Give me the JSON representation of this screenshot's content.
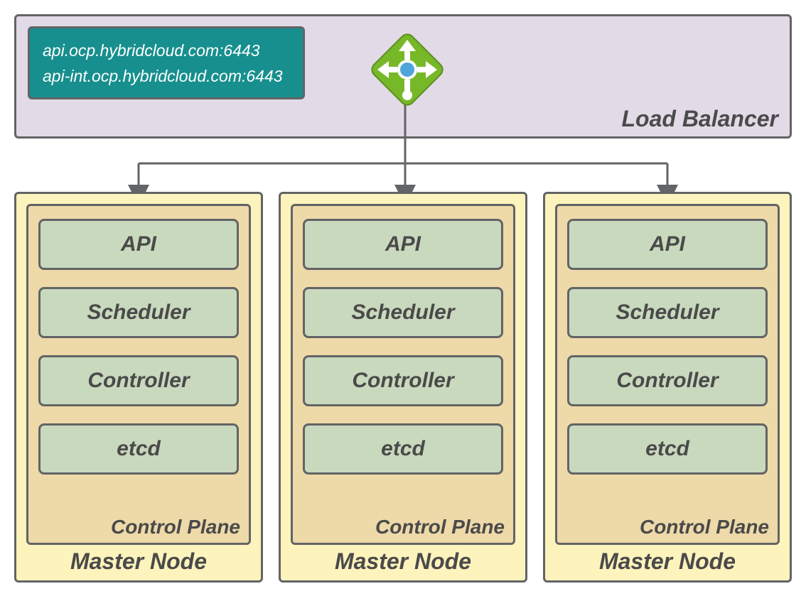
{
  "load_balancer": {
    "label": "Load Balancer",
    "endpoints": [
      "api.ocp.hybridcloud.com:6443",
      "api-int.ocp.hybridcloud.com:6443"
    ],
    "icon": "load-balancer-router-icon"
  },
  "masters": [
    {
      "label": "Master Node",
      "control_plane": {
        "label": "Control Plane",
        "components": [
          "API",
          "Scheduler",
          "Controller",
          "etcd"
        ]
      }
    },
    {
      "label": "Master Node",
      "control_plane": {
        "label": "Control Plane",
        "components": [
          "API",
          "Scheduler",
          "Controller",
          "etcd"
        ]
      }
    },
    {
      "label": "Master Node",
      "control_plane": {
        "label": "Control Plane",
        "components": [
          "API",
          "Scheduler",
          "Controller",
          "etcd"
        ]
      }
    }
  ],
  "colors": {
    "lb_bg": "#e2dae7",
    "endpoint_bg": "#178f8e",
    "master_bg": "#fdf3bc",
    "cp_bg": "#eed9a8",
    "comp_bg": "#c9d9bd",
    "border": "#626466",
    "icon_green": "#77b829",
    "icon_blue": "#4ea5d9"
  }
}
